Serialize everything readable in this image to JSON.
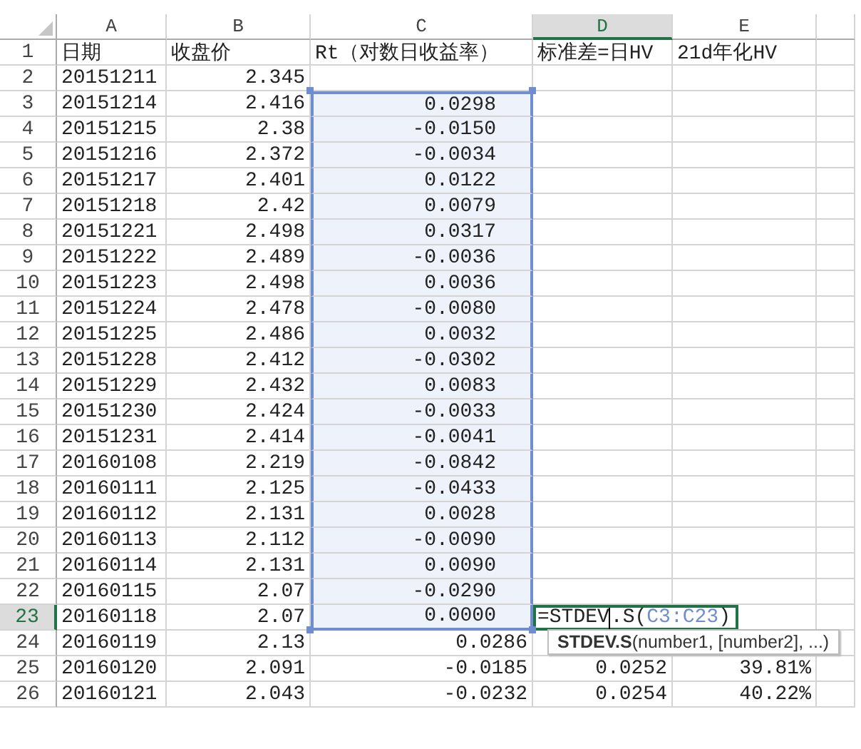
{
  "columns": [
    {
      "letter": "A",
      "selected": false
    },
    {
      "letter": "B",
      "selected": false
    },
    {
      "letter": "C",
      "selected": false
    },
    {
      "letter": "D",
      "selected": true
    },
    {
      "letter": "E",
      "selected": false
    }
  ],
  "rows": [
    {
      "number": "1",
      "selected": false,
      "in_range": false,
      "a": "日期",
      "b": "收盘价",
      "c": "Rt（对数日收益率）",
      "d": "标准差=日HV",
      "e": "21d年化HV"
    },
    {
      "number": "2",
      "selected": false,
      "in_range": false,
      "a": "20151211",
      "b": "2.345"
    },
    {
      "number": "3",
      "selected": false,
      "in_range": true,
      "a": "20151214",
      "b": "2.416",
      "c": "0.0298"
    },
    {
      "number": "4",
      "selected": false,
      "in_range": true,
      "a": "20151215",
      "b": "2.38",
      "c": "-0.0150"
    },
    {
      "number": "5",
      "selected": false,
      "in_range": true,
      "a": "20151216",
      "b": "2.372",
      "c": "-0.0034"
    },
    {
      "number": "6",
      "selected": false,
      "in_range": true,
      "a": "20151217",
      "b": "2.401",
      "c": "0.0122"
    },
    {
      "number": "7",
      "selected": false,
      "in_range": true,
      "a": "20151218",
      "b": "2.42",
      "c": "0.0079"
    },
    {
      "number": "8",
      "selected": false,
      "in_range": true,
      "a": "20151221",
      "b": "2.498",
      "c": "0.0317"
    },
    {
      "number": "9",
      "selected": false,
      "in_range": true,
      "a": "20151222",
      "b": "2.489",
      "c": "-0.0036"
    },
    {
      "number": "10",
      "selected": false,
      "in_range": true,
      "a": "20151223",
      "b": "2.498",
      "c": "0.0036"
    },
    {
      "number": "11",
      "selected": false,
      "in_range": true,
      "a": "20151224",
      "b": "2.478",
      "c": "-0.0080"
    },
    {
      "number": "12",
      "selected": false,
      "in_range": true,
      "a": "20151225",
      "b": "2.486",
      "c": "0.0032"
    },
    {
      "number": "13",
      "selected": false,
      "in_range": true,
      "a": "20151228",
      "b": "2.412",
      "c": "-0.0302"
    },
    {
      "number": "14",
      "selected": false,
      "in_range": true,
      "a": "20151229",
      "b": "2.432",
      "c": "0.0083"
    },
    {
      "number": "15",
      "selected": false,
      "in_range": true,
      "a": "20151230",
      "b": "2.424",
      "c": "-0.0033"
    },
    {
      "number": "16",
      "selected": false,
      "in_range": true,
      "a": "20151231",
      "b": "2.414",
      "c": "-0.0041"
    },
    {
      "number": "17",
      "selected": false,
      "in_range": true,
      "a": "20160108",
      "b": "2.219",
      "c": "-0.0842"
    },
    {
      "number": "18",
      "selected": false,
      "in_range": true,
      "a": "20160111",
      "b": "2.125",
      "c": "-0.0433"
    },
    {
      "number": "19",
      "selected": false,
      "in_range": true,
      "a": "20160112",
      "b": "2.131",
      "c": "0.0028"
    },
    {
      "number": "20",
      "selected": false,
      "in_range": true,
      "a": "20160113",
      "b": "2.112",
      "c": "-0.0090"
    },
    {
      "number": "21",
      "selected": false,
      "in_range": true,
      "a": "20160114",
      "b": "2.131",
      "c": "0.0090"
    },
    {
      "number": "22",
      "selected": false,
      "in_range": true,
      "a": "20160115",
      "b": "2.07",
      "c": "-0.0290"
    },
    {
      "number": "23",
      "selected": true,
      "in_range": true,
      "a": "20160118",
      "b": "2.07",
      "c": "0.0000",
      "formula": [
        {
          "kind": "text",
          "text": "=STDEV"
        },
        {
          "kind": "cursor"
        },
        {
          "kind": "text",
          "text": ".S("
        },
        {
          "kind": "ref",
          "text": "C3:C23"
        },
        {
          "kind": "text",
          "text": ")"
        }
      ]
    },
    {
      "number": "24",
      "selected": false,
      "in_range": false,
      "a": "20160119",
      "b": "2.13",
      "c": "0.0286"
    },
    {
      "number": "25",
      "selected": false,
      "in_range": false,
      "a": "20160120",
      "b": "2.091",
      "c": "-0.0185",
      "d": "0.0252",
      "e": "39.81%"
    },
    {
      "number": "26",
      "selected": false,
      "in_range": false,
      "a": "20160121",
      "b": "2.043",
      "c": "-0.0232",
      "d": "0.0254",
      "e": "40.22%"
    }
  ],
  "tooltip": "**STDEV.S**(number1, [number2], ...)"
}
